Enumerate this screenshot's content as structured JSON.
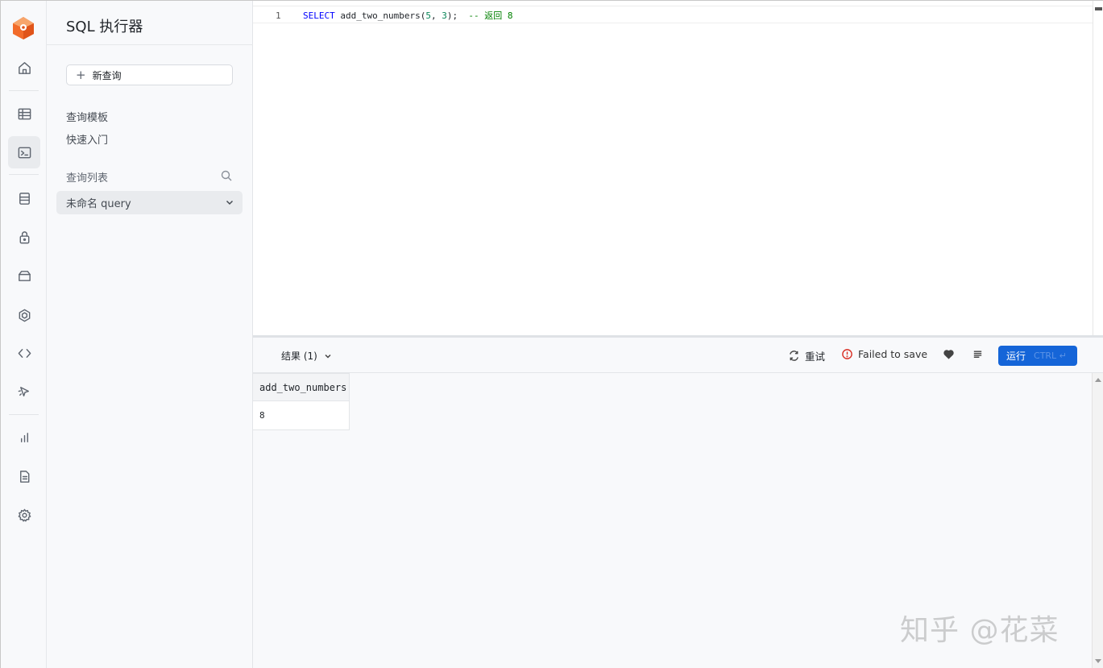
{
  "rail": {
    "items": [
      {
        "name": "home-icon"
      },
      {
        "name": "table-editor-icon"
      },
      {
        "name": "sql-editor-icon",
        "active": true
      },
      {
        "name": "database-icon"
      },
      {
        "name": "auth-lock-icon"
      },
      {
        "name": "storage-icon"
      },
      {
        "name": "edge-functions-icon"
      },
      {
        "name": "api-code-icon"
      },
      {
        "name": "advisors-pointer-icon"
      },
      {
        "name": "reports-chart-icon"
      },
      {
        "name": "logs-document-icon"
      },
      {
        "name": "settings-gear-icon"
      }
    ]
  },
  "sidebar": {
    "title": "SQL 执行器",
    "new_query": "新查询",
    "links": [
      "查询模板",
      "快速入门"
    ],
    "section": "查询列表",
    "query_item": "未命名 query"
  },
  "editor": {
    "line_number": "1",
    "code": {
      "keyword": "SELECT",
      "fn": "add_two_numbers",
      "open": "(",
      "arg1": "5",
      "sep": ", ",
      "arg2": "3",
      "close": ");",
      "comment": "  -- 返回 8"
    }
  },
  "toolbar": {
    "results_tab": "结果 (1)",
    "retry": "重试",
    "save_status": "Failed to save",
    "run": "运行",
    "run_hint": "CTRL ↵"
  },
  "results": {
    "columns": [
      "add_two_numbers"
    ],
    "rows": [
      [
        "8"
      ]
    ]
  },
  "watermark": "知乎 @花菜",
  "colors": {
    "accent": "#1565d8",
    "logo": "#f26b2a",
    "error": "#d93025"
  }
}
